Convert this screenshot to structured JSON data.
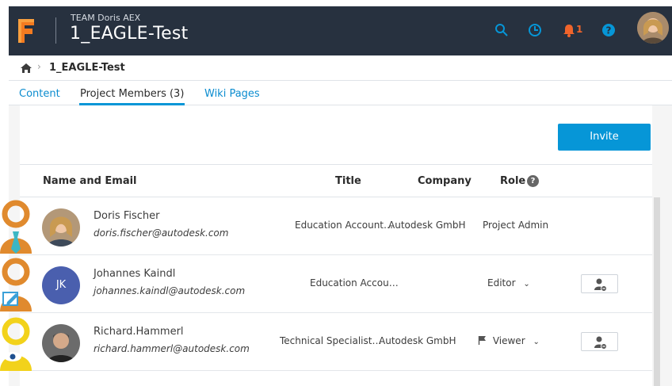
{
  "header": {
    "team": "TEAM Doris AEX",
    "project": "1_EAGLE-Test",
    "notification_count": "1",
    "colors": {
      "bg": "#27313f",
      "accent": "#0696d7",
      "bell": "#f0642b"
    },
    "icons": [
      "search-icon",
      "clock-icon",
      "bell-icon",
      "help-icon"
    ]
  },
  "breadcrumb": {
    "current": "1_EAGLE-Test"
  },
  "tabs": [
    {
      "label": "Content"
    },
    {
      "label": "Project Members (3)"
    },
    {
      "label": "Wiki Pages"
    }
  ],
  "toolbar": {
    "invite_label": "Invite"
  },
  "table": {
    "columns": {
      "name": "Name and Email",
      "title": "Title",
      "company": "Company",
      "role": "Role"
    },
    "rows": [
      {
        "name": "Doris Fischer",
        "email": "doris.fischer@autodesk.com",
        "title": "Education Account…",
        "company": "Autodesk GmbH",
        "role": "Project Admin"
      },
      {
        "initials": "JK",
        "name": "Johannes Kaindl",
        "email": "johannes.kaindl@autodesk.com",
        "title": "Education Accou…",
        "company": "",
        "role": "Editor"
      },
      {
        "name": "Richard.Hammerl",
        "email": "richard.hammerl@autodesk.com",
        "title": "Technical Specialist…",
        "company": "Autodesk GmbH",
        "role": "Viewer"
      }
    ]
  }
}
